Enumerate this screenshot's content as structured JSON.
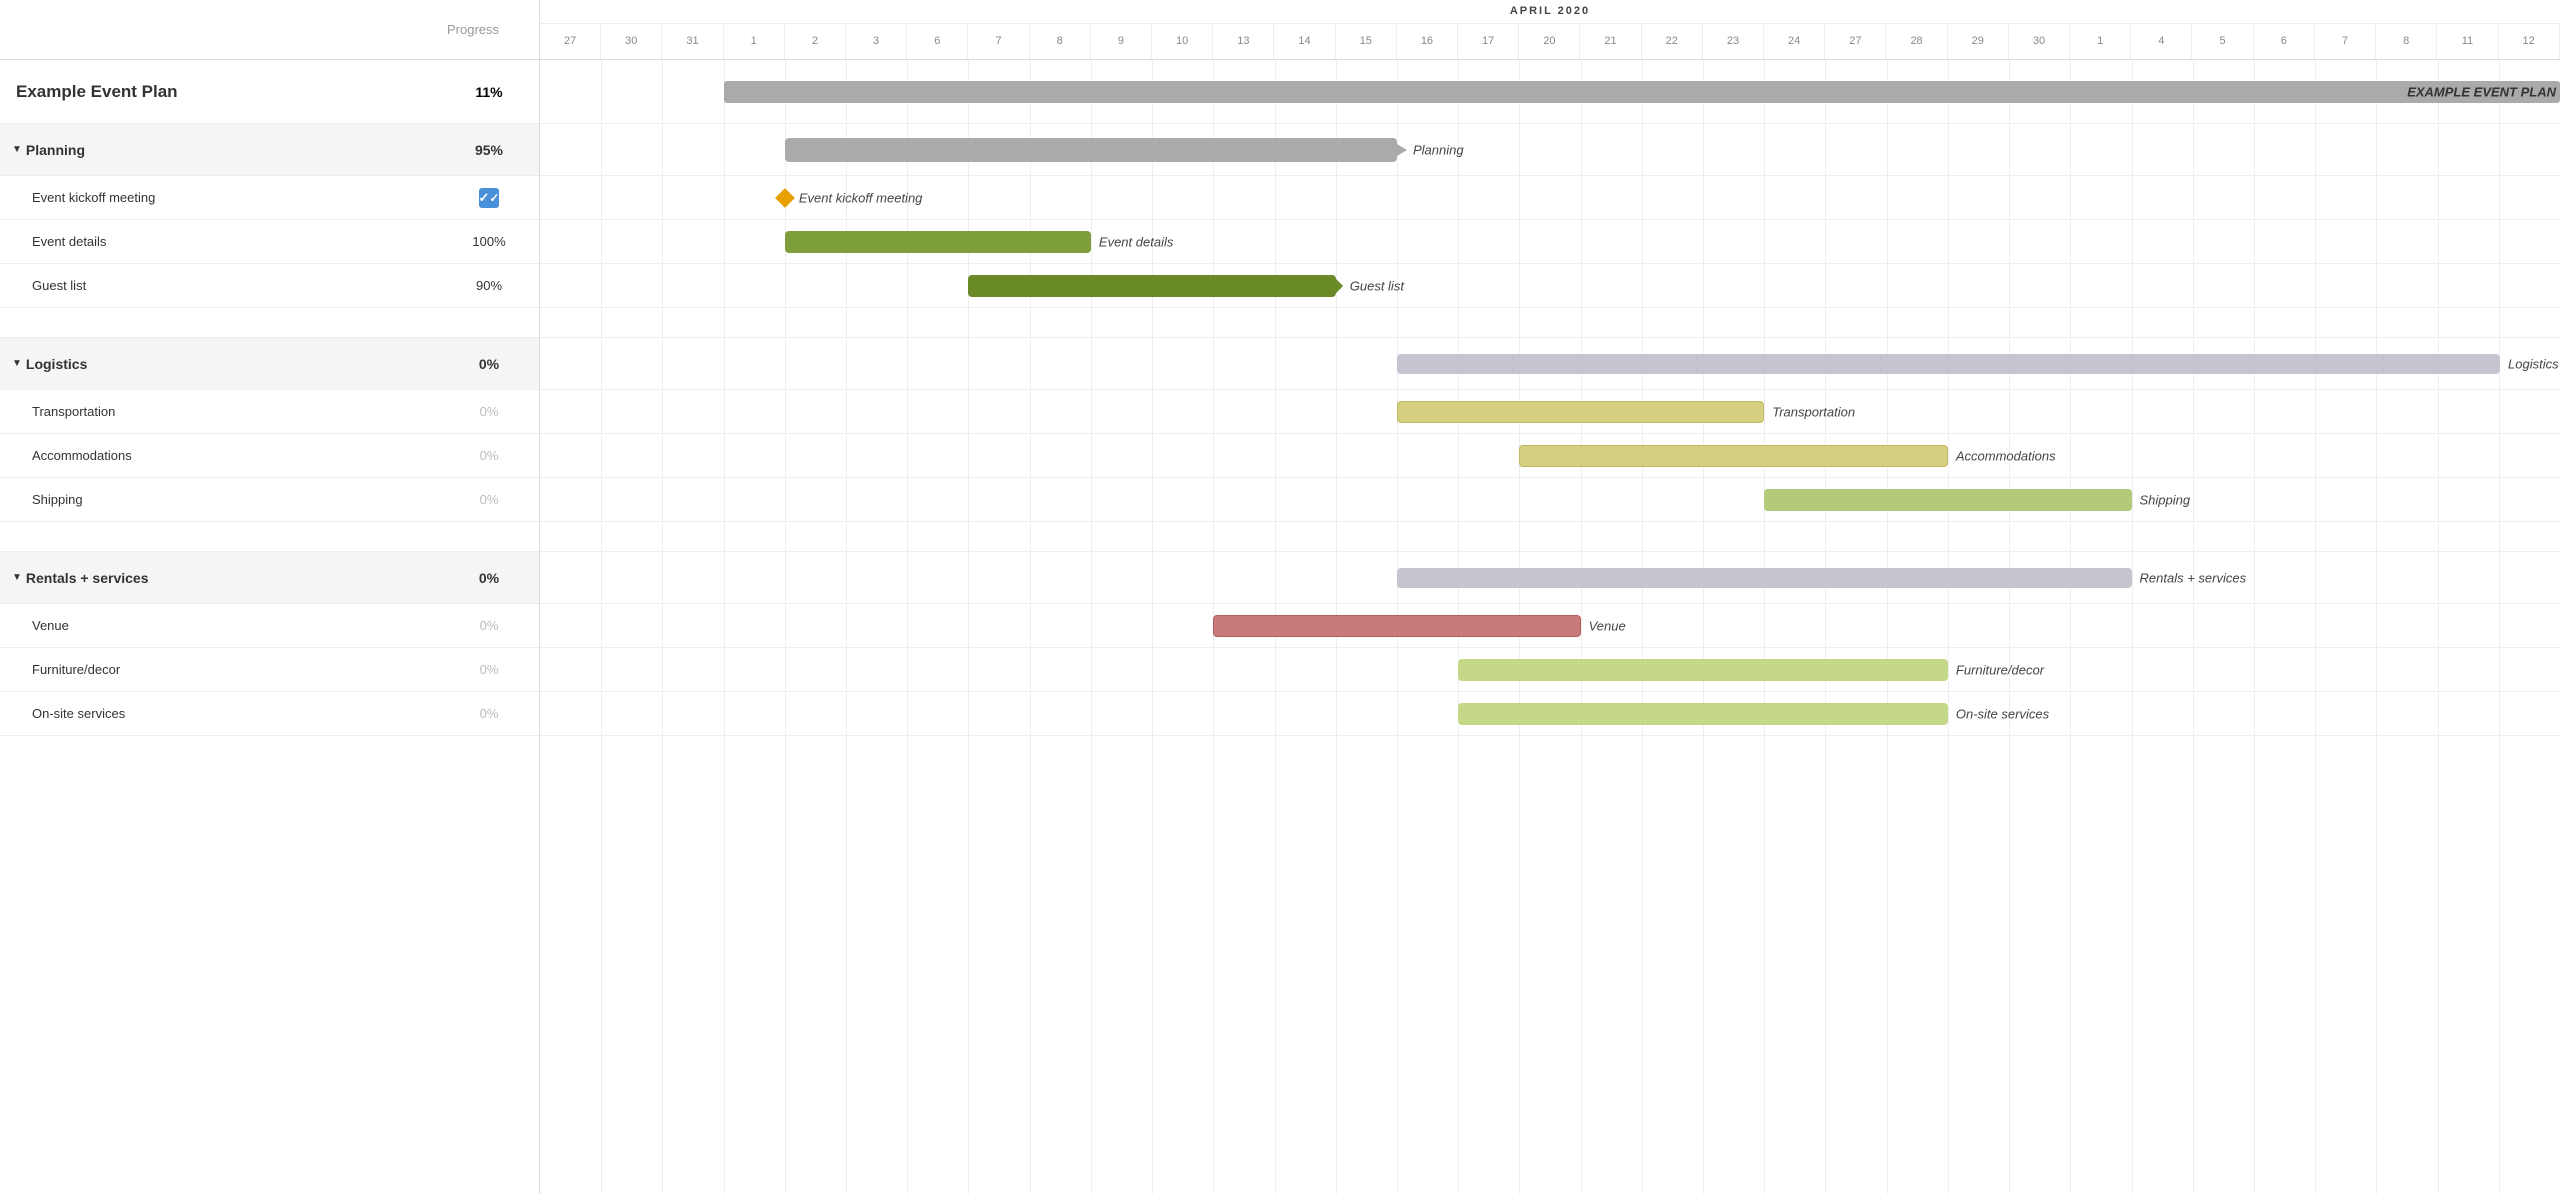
{
  "header": {
    "col_name": "",
    "col_progress": "Progress",
    "month": "APRIL 2020",
    "days": [
      "27",
      "30",
      "31",
      "1",
      "2",
      "3",
      "6",
      "7",
      "8",
      "9",
      "10",
      "13",
      "14",
      "15",
      "16",
      "17",
      "20",
      "21",
      "22",
      "23",
      "24",
      "27",
      "28",
      "29",
      "30",
      "1",
      "4",
      "5",
      "6",
      "7",
      "8",
      "11",
      "12"
    ]
  },
  "rows": [
    {
      "type": "top",
      "name": "Example Event Plan",
      "progress": "11%",
      "bold": true
    },
    {
      "type": "group",
      "name": "Planning",
      "progress": "95%"
    },
    {
      "type": "task",
      "name": "Event kickoff meeting",
      "progress": "check",
      "indent": true
    },
    {
      "type": "task",
      "name": "Event details",
      "progress": "100%",
      "indent": true
    },
    {
      "type": "task",
      "name": "Guest list",
      "progress": "90%",
      "indent": true
    },
    {
      "type": "spacer"
    },
    {
      "type": "group",
      "name": "Logistics",
      "progress": "0%"
    },
    {
      "type": "task",
      "name": "Transportation",
      "progress": "0%",
      "indent": true,
      "muted": true
    },
    {
      "type": "task",
      "name": "Accommodations",
      "progress": "0%",
      "indent": true,
      "muted": true
    },
    {
      "type": "task",
      "name": "Shipping",
      "progress": "0%",
      "indent": true,
      "muted": true
    },
    {
      "type": "spacer"
    },
    {
      "type": "group",
      "name": "Rentals + services",
      "progress": "0%"
    },
    {
      "type": "task",
      "name": "Venue",
      "progress": "0%",
      "indent": true,
      "muted": true
    },
    {
      "type": "task",
      "name": "Furniture/decor",
      "progress": "0%",
      "indent": true,
      "muted": true
    },
    {
      "type": "task",
      "name": "On-site services",
      "progress": "0%",
      "indent": true,
      "muted": true
    }
  ],
  "bars": {
    "main_bar": {
      "label": "EXAMPLE EVENT PLAN",
      "color": "#aaa"
    },
    "planning_bar": {
      "label": "Planning",
      "color": "#aaa"
    },
    "event_details_bar": {
      "label": "Event details",
      "color": "#7d9e3a"
    },
    "guest_list_bar": {
      "label": "Guest list",
      "color": "#6a8a28"
    },
    "logistics_bar": {
      "label": "Logistics",
      "color": "#c5c5d0"
    },
    "transport_bar": {
      "label": "Transportation",
      "color": "#d4d080"
    },
    "accom_bar": {
      "label": "Accommodations",
      "color": "#d4d080"
    },
    "shipping_bar": {
      "label": "Shipping",
      "color": "#b5c97a"
    },
    "rentals_bar": {
      "label": "Rentals + services",
      "color": "#c5c5d0"
    },
    "venue_bar": {
      "label": "Venue",
      "color": "#c97a7a"
    },
    "furniture_bar": {
      "label": "Furniture/decor",
      "color": "#c5d888"
    },
    "onsite_bar": {
      "label": "On-site services",
      "color": "#c5d888"
    }
  },
  "colors": {
    "group_bg": "#f5f5f5",
    "border": "#ddd",
    "accent_blue": "#4a90d9",
    "milestone_orange": "#e8a000"
  }
}
